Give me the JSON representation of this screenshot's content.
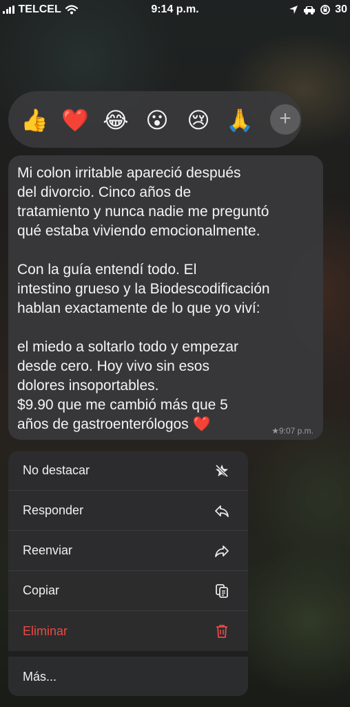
{
  "status_bar": {
    "carrier": "TELCEL",
    "time": "9:14 p.m.",
    "battery": "30"
  },
  "reactions": [
    {
      "emoji": "👍",
      "icon": "thumbs-up"
    },
    {
      "emoji": "❤️",
      "icon": "red-heart"
    },
    {
      "emoji": "😂",
      "icon": "tears-of-joy"
    },
    {
      "emoji": "😮",
      "icon": "surprised-face"
    },
    {
      "emoji": "😢",
      "icon": "crying-face"
    },
    {
      "emoji": "🙏",
      "icon": "folded-hands"
    }
  ],
  "message": {
    "paragraph_1": "Mi colon irritable apareció después\ndel divorcio. Cinco años de\ntratamiento y nunca nadie me preguntó\nqué estaba viviendo emocionalmente.",
    "paragraph_2": "Con la guía entendí todo. El\nintestino grueso y la Biodescodificación\nhablan exactamente de lo que yo viví:",
    "paragraph_3": "el miedo a soltarlo todo y empezar\ndesde cero. Hoy vivo sin esos\ndolores insoportables.\n$9.90 que me cambió más que 5\naños de gastroenterólogos ❤️",
    "time": "★9:07 p.m."
  },
  "menu": {
    "items": [
      {
        "label": "No destacar",
        "icon": "unstar-icon"
      },
      {
        "label": "Responder",
        "icon": "reply-icon"
      },
      {
        "label": "Reenviar",
        "icon": "forward-icon"
      },
      {
        "label": "Copiar",
        "icon": "copy-icon"
      },
      {
        "label": "Eliminar",
        "icon": "trash-icon"
      },
      {
        "label": "Más...",
        "icon": ""
      }
    ],
    "danger_color": "#ea4a45"
  }
}
